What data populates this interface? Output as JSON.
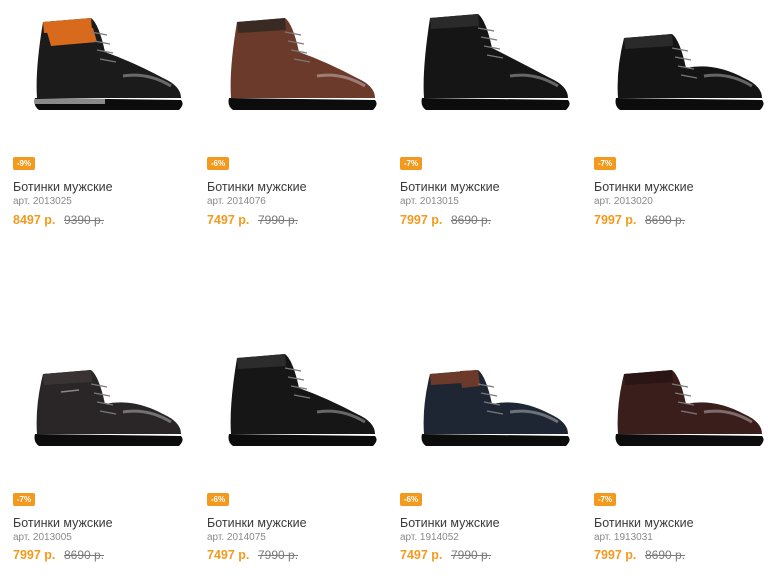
{
  "colors": {
    "accent": "#f39a1e",
    "title": "#3a3a3a",
    "sku": "#8a8a8a",
    "old_price": "#7a7a7a"
  },
  "products": [
    {
      "discount": "-9%",
      "title": "Ботинки мужские",
      "sku": "арт. 2013025",
      "price": "8497 р.",
      "old_price": "9390 р.",
      "shoe_color": "#1b1b1b",
      "accent_color": "#d86a1e",
      "variant": "hiking"
    },
    {
      "discount": "-6%",
      "title": "Ботинки мужские",
      "sku": "арт. 2014076",
      "price": "7497 р.",
      "old_price": "7990 р.",
      "shoe_color": "#6b3a2a",
      "accent_color": "#3a2a24",
      "variant": "high"
    },
    {
      "discount": "-7%",
      "title": "Ботинки мужские",
      "sku": "арт. 2013015",
      "price": "7997 р.",
      "old_price": "8690 р.",
      "shoe_color": "#151515",
      "accent_color": "#2a2a2a",
      "variant": "brogue"
    },
    {
      "discount": "-7%",
      "title": "Ботинки мужские",
      "sku": "арт. 2013020",
      "price": "7997 р.",
      "old_price": "8690 р.",
      "shoe_color": "#141414",
      "accent_color": "#2a2a2a",
      "variant": "chukka"
    },
    {
      "discount": "-7%",
      "title": "Ботинки мужские",
      "sku": "арт. 2013005",
      "price": "7997 р.",
      "old_price": "8690 р.",
      "shoe_color": "#2a2526",
      "accent_color": "#3a3334",
      "variant": "zip"
    },
    {
      "discount": "-6%",
      "title": "Ботинки мужские",
      "sku": "арт. 2014075",
      "price": "7497 р.",
      "old_price": "7990 р.",
      "shoe_color": "#161616",
      "accent_color": "#2c2c2c",
      "variant": "high"
    },
    {
      "discount": "-6%",
      "title": "Ботинки мужские",
      "sku": "арт. 1914052",
      "price": "7497 р.",
      "old_price": "7990 р.",
      "shoe_color": "#1e2633",
      "accent_color": "#6b3a2a",
      "variant": "navy"
    },
    {
      "discount": "-7%",
      "title": "Ботинки мужские",
      "sku": "арт. 1913031",
      "price": "7997 р.",
      "old_price": "8690 р.",
      "shoe_color": "#3a1e1c",
      "accent_color": "#2a1414",
      "variant": "chukka"
    }
  ]
}
